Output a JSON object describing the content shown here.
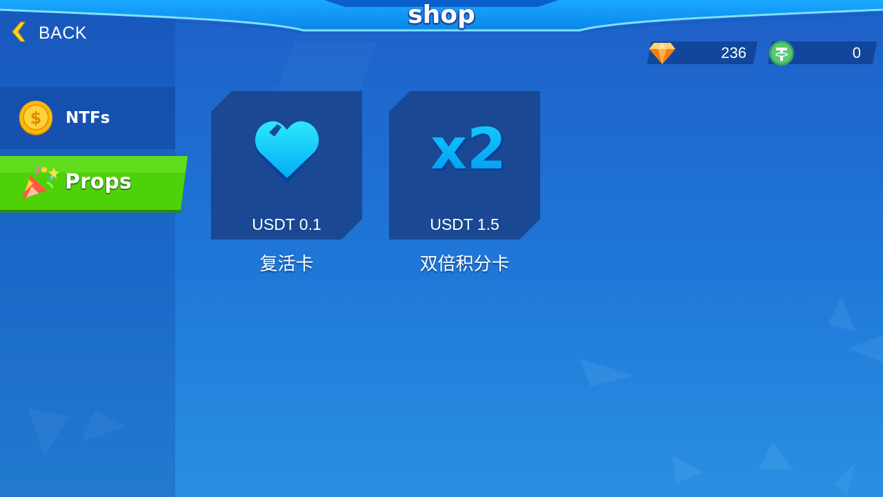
{
  "header": {
    "title": "shop",
    "back_label": "BACK"
  },
  "currencies": [
    {
      "icon": "diamond-icon",
      "value": "236"
    },
    {
      "icon": "usdt-coin-icon",
      "value": "0"
    }
  ],
  "sidebar": {
    "items": [
      {
        "label": "NTFs",
        "icon": "gold-coin-icon",
        "selected": false
      },
      {
        "label": "Props",
        "icon": "party-popper-icon",
        "selected": true
      }
    ]
  },
  "shop_items": [
    {
      "icon": "heart-icon",
      "price": "USDT 0.1",
      "name": "复活卡"
    },
    {
      "icon": "x2-multiplier-icon",
      "price": "USDT 1.5",
      "name": "双倍积分卡",
      "icon_text": "x2"
    }
  ],
  "colors": {
    "accent_green": "#4fd10a",
    "card_bg": "#1a4892",
    "icon_cyan": "#14d0ff",
    "back_yellow": "#ffd21a"
  }
}
